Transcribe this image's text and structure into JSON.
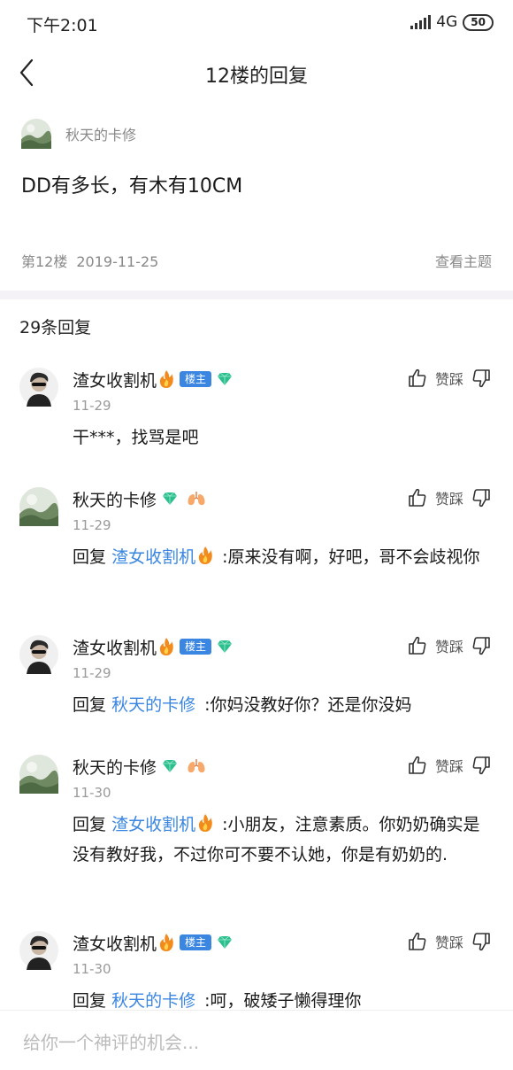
{
  "status_bar": {
    "time": "下午2:01",
    "network": "4G",
    "battery": "50"
  },
  "nav": {
    "title": "12楼的回复"
  },
  "post": {
    "author": "秋天的卡修",
    "content": "DD有多长，有木有10CM",
    "floor": "第12楼",
    "date": "2019-11-25",
    "view_topic": "查看主题"
  },
  "reply_count": "29条回复",
  "labels": {
    "vote": "赞踩",
    "reply_prefix": "回复",
    "lz_badge": "楼主"
  },
  "comments": [
    {
      "author": "渣女收割机",
      "date": "11-29",
      "text": "干***，找骂是吧"
    },
    {
      "author": "秋天的卡修",
      "date": "11-29",
      "reply_to": "渣女收割机",
      "text": ":原来没有啊，好吧，哥不会歧视你"
    },
    {
      "author": "渣女收割机",
      "date": "11-29",
      "reply_to": "秋天的卡修",
      "text": ":你妈没教好你？还是你没妈"
    },
    {
      "author": "秋天的卡修",
      "date": "11-30",
      "reply_to": "渣女收割机",
      "text": ":小朋友，注意素质。你奶奶确实是没有教好我，不过你可不要不认她，你是有奶奶的."
    },
    {
      "author": "渣女收割机",
      "date": "11-30",
      "reply_to": "秋天的卡修",
      "text": ":呵，破矮子懒得理你"
    }
  ],
  "comment_input": {
    "placeholder": "给你一个神评的机会..."
  },
  "colors": {
    "link": "#3a86e0",
    "badge": "#3a86e0",
    "gem": "#2bbf8e",
    "divider": "#f4f2f6"
  }
}
